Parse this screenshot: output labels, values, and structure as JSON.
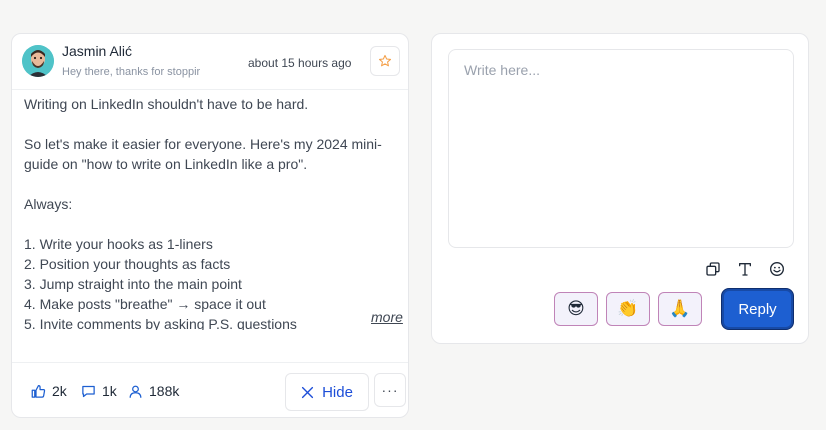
{
  "post": {
    "author_name": "Jasmin Alić",
    "author_subtitle": "Hey there, thanks for stoppir",
    "time": "about 15 hours ago",
    "body": "Writing on LinkedIn shouldn't have to be hard.\n\nSo let's make it easier for everyone. Here's my 2024 mini-guide on \"how to write on LinkedIn like a pro\".\n\nAlways:\n\n1. Write your hooks as 1-liners\n2. Position your thoughts as facts\n3. Jump straight into the main point\n4. Make posts \"breathe\" → space it out\n5. Invite comments by asking P.S. questions",
    "more_label": "more",
    "stats": {
      "likes": "2k",
      "comments": "1k",
      "reach": "188k"
    },
    "hide_label": "Hide",
    "more_menu_label": "···"
  },
  "reply": {
    "placeholder": "Write here...",
    "value": "",
    "emojis": [
      "😎",
      "👏",
      "🙏"
    ],
    "submit_label": "Reply"
  },
  "icons": {
    "star": "star-icon",
    "like": "thumbs-up-icon",
    "comment": "comment-icon",
    "reach": "person-icon",
    "hide": "close-icon",
    "copy": "copy-icon",
    "text": "text-format-icon",
    "emoji": "smiley-icon"
  },
  "colors": {
    "accent": "#1d5fd1",
    "hide_text": "#1d4ed8",
    "star": "#f4a04a",
    "emoji_border": "#c084b8"
  }
}
